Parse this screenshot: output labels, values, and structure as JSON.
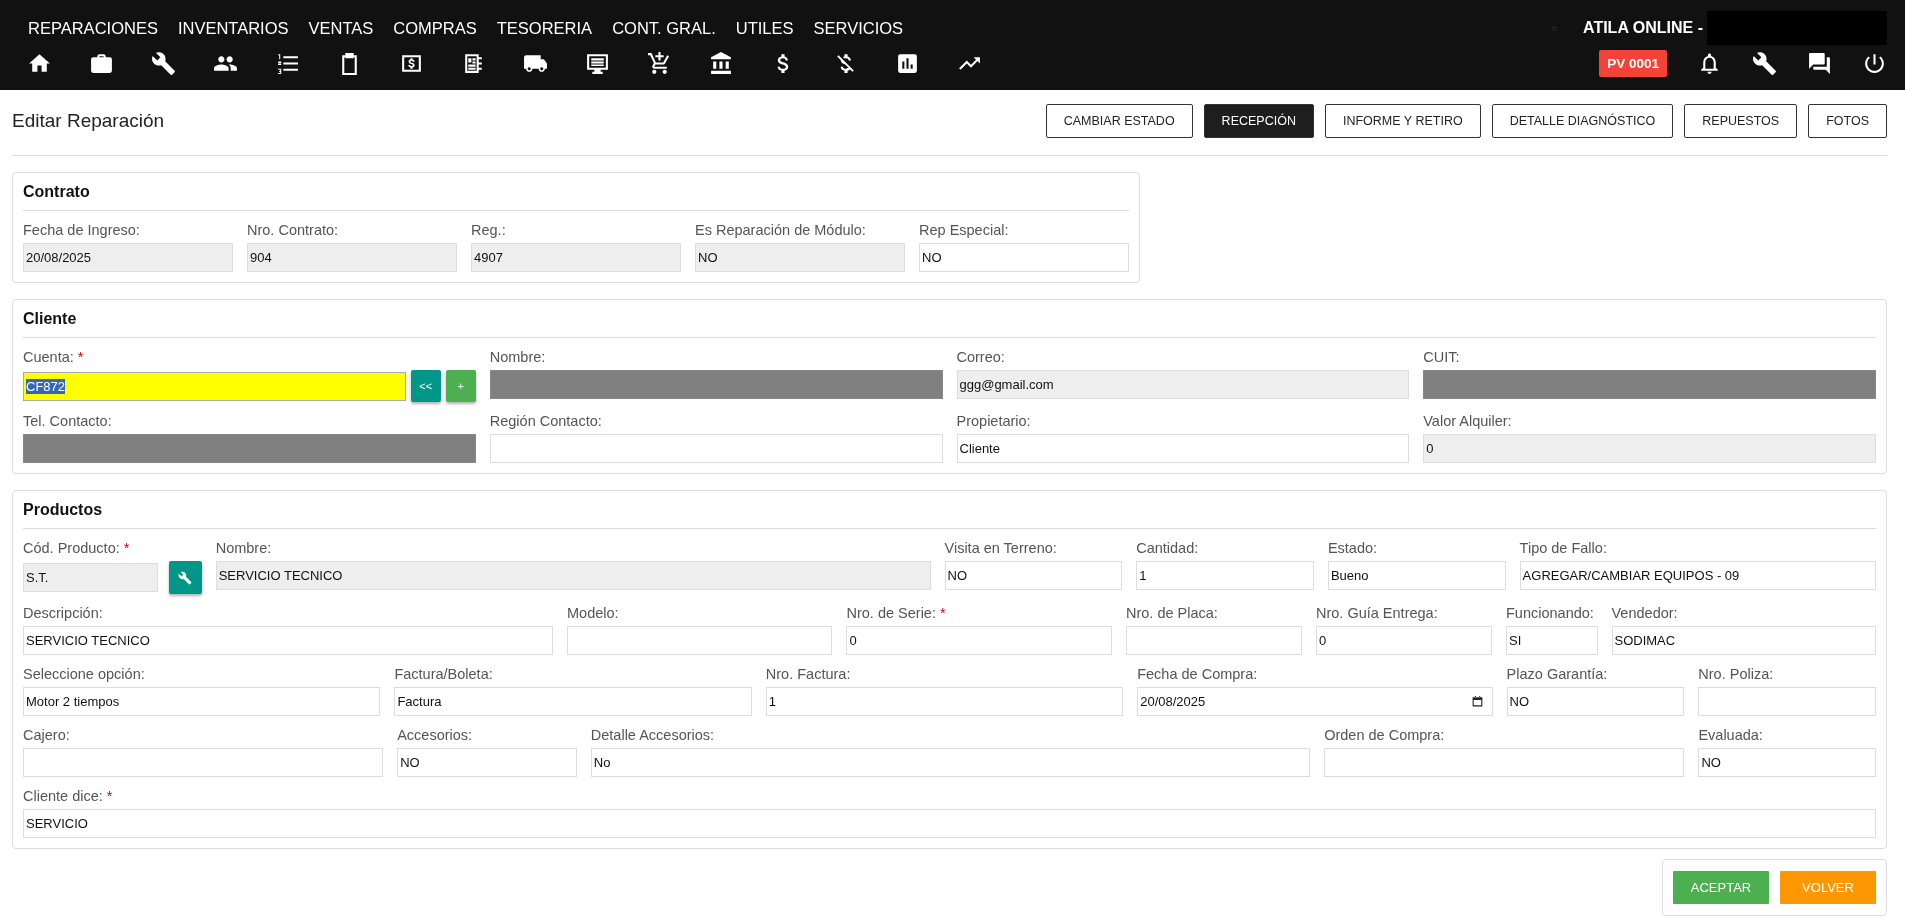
{
  "top_menu": [
    "REPARACIONES",
    "INVENTARIOS",
    "VENTAS",
    "COMPRAS",
    "TESORERIA",
    "CONT. GRAL.",
    "UTILES",
    "SERVICIOS"
  ],
  "user": {
    "label": "ATILA ONLINE -",
    "redacted": true
  },
  "point_of_sale": "PV 0001",
  "page_title": "Editar Reparación",
  "tabs": [
    {
      "label": "CAMBIAR ESTADO",
      "selected": false
    },
    {
      "label": "RECEPCIÓN",
      "selected": true
    },
    {
      "label": "INFORME Y RETIRO",
      "selected": false
    },
    {
      "label": "DETALLE DIAGNÓSTICO",
      "selected": false
    },
    {
      "label": "REPUESTOS",
      "selected": false
    },
    {
      "label": "FOTOS",
      "selected": false
    }
  ],
  "sections": [
    {
      "title": "Contrato",
      "lines": [
        {
          "fields": [
            {
              "label": "Fecha de Ingreso:",
              "value": "20/08/2025",
              "kind": "readonly"
            },
            {
              "label": "Nro. Contrato:",
              "value": "904",
              "kind": "readonly"
            },
            {
              "label": "Reg.:",
              "value": "4907",
              "kind": "readonly"
            },
            {
              "label": "Es Reparación de Módulo:",
              "value": "NO",
              "kind": "readonly"
            },
            {
              "label": "Rep Especial:",
              "value": "NO",
              "kind": "text"
            }
          ]
        }
      ]
    },
    {
      "title": "Cliente",
      "lines": [
        {
          "fields": [
            {
              "label": "Cuenta:",
              "required_mark": "*",
              "value": "CF872",
              "kind": "highlighted",
              "buttons": [
                {
                  "label": "<<",
                  "color": "#009688"
                },
                {
                  "label": "+",
                  "color": "#4caf50"
                }
              ]
            },
            {
              "label": "Nombre:",
              "kind": "redacted"
            },
            {
              "label": "Correo:",
              "value": "ggg@gmail.com",
              "kind": "readonly"
            },
            {
              "label": "CUIT:",
              "kind": "redacted"
            }
          ]
        },
        {
          "fields": [
            {
              "label": "Tel. Contacto:",
              "kind": "redacted"
            },
            {
              "label": "Región Contacto:",
              "kind": "text"
            },
            {
              "label": "Propietario:",
              "value": "Cliente",
              "kind": "text"
            },
            {
              "label": "Valor Alquiler:",
              "value": "0",
              "kind": "readonly"
            }
          ]
        }
      ]
    },
    {
      "title": "Productos",
      "lines": [
        {
          "fields": [
            {
              "label": "Cód. Producto:",
              "required_mark": "*",
              "value": "S.T.",
              "kind": "readonly",
              "tool_button": true
            },
            {
              "label": "Nombre:",
              "value": "SERVICIO TECNICO",
              "kind": "readonly"
            },
            {
              "label": "Visita en Terreno:",
              "value": "NO",
              "kind": "text"
            },
            {
              "label": "Cantidad:",
              "value": "1",
              "kind": "text"
            },
            {
              "label": "Estado:",
              "value": "Bueno",
              "kind": "text"
            },
            {
              "label": "Tipo de Fallo:",
              "value": "AGREGAR/CAMBIAR EQUIPOS - 09",
              "kind": "text"
            }
          ]
        },
        {
          "fields": [
            {
              "label": "Descripción:",
              "value": "SERVICIO TECNICO",
              "kind": "text"
            },
            {
              "label": "Modelo:",
              "kind": "text"
            },
            {
              "label": "Nro. de Serie:",
              "required_mark": "*",
              "value": "0",
              "kind": "text"
            },
            {
              "label": "Nro. de Placa:",
              "kind": "text"
            },
            {
              "label": "Nro. Guía Entrega:",
              "value": "0",
              "kind": "text"
            },
            {
              "label": "Funcionando:",
              "value": "SI",
              "kind": "text"
            },
            {
              "label": "Vendedor:",
              "value": "SODIMAC",
              "kind": "text"
            }
          ]
        },
        {
          "fields": [
            {
              "label": "Seleccione opción:",
              "value": "Motor 2 tiempos",
              "kind": "text"
            },
            {
              "label": "Factura/Boleta:",
              "value": "Factura",
              "kind": "text"
            },
            {
              "label": "Nro. Factura:",
              "value": "1",
              "kind": "text"
            },
            {
              "label": "Fecha de Compra:",
              "value": "20/08/2025",
              "kind": "date"
            },
            {
              "label": "Plazo Garantía:",
              "value": "NO",
              "kind": "text"
            },
            {
              "label": "Nro. Poliza:",
              "kind": "text"
            }
          ]
        },
        {
          "fields": [
            {
              "label": "Cajero:",
              "kind": "text"
            },
            {
              "label": "Accesorios:",
              "value": "NO",
              "kind": "text"
            },
            {
              "label": "Detalle Accesorios:",
              "value": "No",
              "kind": "text"
            },
            {
              "label": "Orden de Compra:",
              "kind": "text"
            },
            {
              "label": "Evaluada:",
              "value": "NO",
              "kind": "text"
            }
          ]
        },
        {
          "fields": [
            {
              "label": "Cliente dice:",
              "required_mark": "*",
              "value": "SERVICIO",
              "kind": "text"
            }
          ]
        }
      ]
    }
  ],
  "actions": [
    {
      "label": "ACEPTAR",
      "color": "#4caf50"
    },
    {
      "label": "VOLVER",
      "color": "#ff9800"
    }
  ]
}
